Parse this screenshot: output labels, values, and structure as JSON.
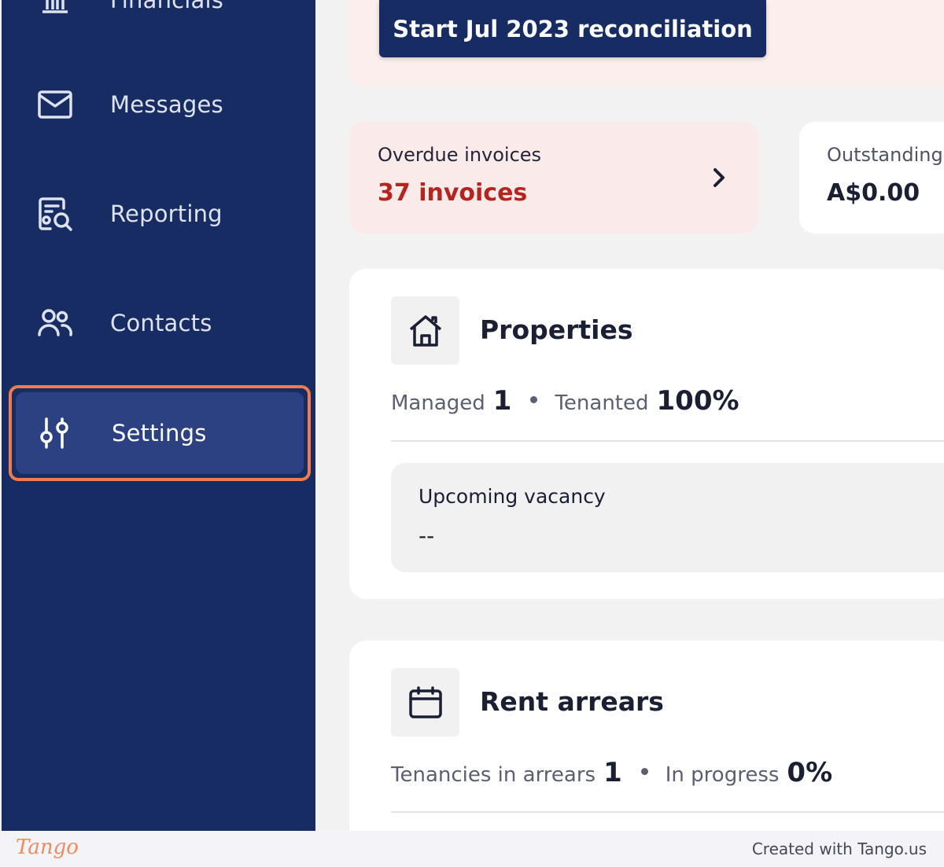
{
  "sidebar": {
    "items": [
      {
        "label": "Financials",
        "icon": "bank-icon"
      },
      {
        "label": "Messages",
        "icon": "mail-icon"
      },
      {
        "label": "Reporting",
        "icon": "report-search-icon"
      },
      {
        "label": "Contacts",
        "icon": "users-icon"
      },
      {
        "label": "Settings",
        "icon": "sliders-icon",
        "active": true
      }
    ]
  },
  "banner": {
    "button_label": "Start Jul 2023 reconciliation"
  },
  "cards": {
    "overdue": {
      "title": "Overdue invoices",
      "value": "37 invoices"
    },
    "outstanding": {
      "title": "Outstanding",
      "value": "A$0.00"
    }
  },
  "properties": {
    "title": "Properties",
    "managed_label": "Managed",
    "managed_value": "1",
    "tenanted_label": "Tenanted",
    "tenanted_value": "100%",
    "vacancy_title": "Upcoming vacancy",
    "vacancy_value": "--"
  },
  "arrears": {
    "title": "Rent arrears",
    "tenancies_label": "Tenancies in arrears",
    "tenancies_value": "1",
    "progress_label": "In progress",
    "progress_value": "0%"
  },
  "footer": {
    "logo": "Tango",
    "credit": "Created with Tango.us"
  },
  "colors": {
    "sidebar": "#172c63",
    "active_highlight": "#f17a4f",
    "overdue_text": "#b3251e"
  }
}
